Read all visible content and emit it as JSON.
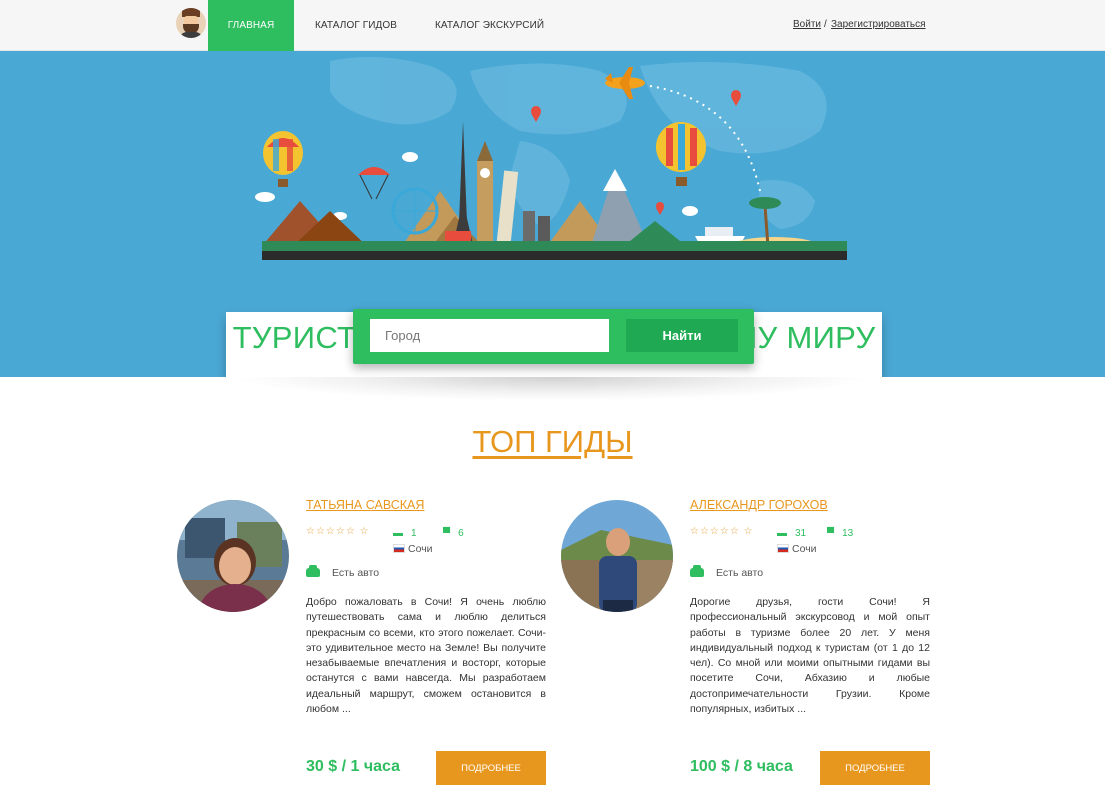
{
  "nav": {
    "home": "ГЛАВНАЯ",
    "guides_catalog": "КАТАЛОГ ГИДОВ",
    "tours_catalog": "КАТАЛОГ ЭКСКУРСИЙ",
    "login": "Войти",
    "separator": "/",
    "register": "Зарегистрироваться"
  },
  "hero": {
    "title": "ТУРИСТИЧЕСКИЕ ГИДЫ ПО ВСЕМУ МИРУ",
    "search_placeholder": "Город",
    "search_value": "",
    "search_button": "Найти"
  },
  "top_guides": {
    "title": "ТОП ГИДЫ",
    "guides": [
      {
        "name": "ТАТЬЯНА САВСКАЯ",
        "stars": "☆☆☆☆☆ ☆",
        "reviews": "1",
        "tours": "6",
        "city": "Сочи",
        "car": "Есть авто",
        "description": "Добро пожаловать в Сочи! Я очень люблю путешествовать сама и люблю делиться прекрасным со всеми, кто этого пожелает. Сочи- это удивительное место на Земле! Вы получите незабываемые впечатления и восторг, которые останутся с вами навсегда. Мы разработаем идеальный маршрут, сможем остановится в любом ...",
        "price": "30 $ / 1 часа",
        "button": "ПОДРОБНЕЕ"
      },
      {
        "name": "АЛЕКСАНДР ГОРОХОВ",
        "stars": "☆☆☆☆☆ ☆",
        "reviews": "31",
        "tours": "13",
        "city": "Сочи",
        "car": "Есть авто",
        "description": "Дорогие друзья, гости Сочи! Я профессиональный экскурсовод и мой опыт работы в туризме более 20 лет. У меня индивидуальный подход к туристам (от 1 до 12 чел). Со мной или моими опытными гидами вы посетите Сочи, Абхазию и любые достопримечательности Грузии. Кроме популярных, избитых ...",
        "price": "100 $ / 8 часа",
        "button": "ПОДРОБНЕЕ"
      }
    ]
  },
  "colors": {
    "accent_green": "#2ebd5f",
    "accent_orange": "#e8971e",
    "hero_blue": "#4aa8d4"
  }
}
